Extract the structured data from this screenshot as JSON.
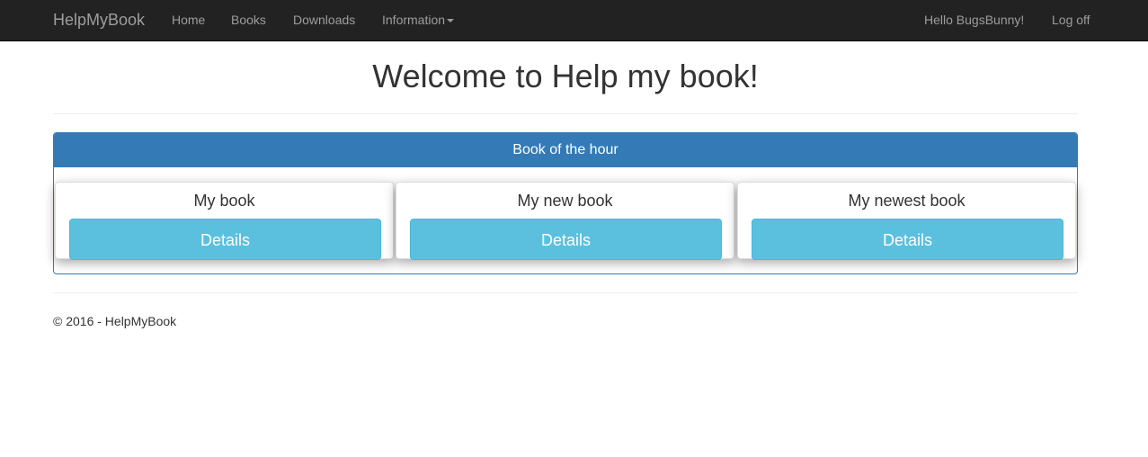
{
  "navbar": {
    "brand": "HelpMyBook",
    "links": [
      {
        "label": "Home"
      },
      {
        "label": "Books"
      },
      {
        "label": "Downloads"
      },
      {
        "label": "Information",
        "has_dropdown": true
      }
    ],
    "greeting": "Hello BugsBunny!",
    "logoff": "Log off"
  },
  "main": {
    "title": "Welcome to Help my book!",
    "panel": {
      "heading": "Book of the hour",
      "books": [
        {
          "title": "My book",
          "button": "Details"
        },
        {
          "title": "My new book",
          "button": "Details"
        },
        {
          "title": "My newest book",
          "button": "Details"
        }
      ]
    }
  },
  "footer": {
    "text": "© 2016 - HelpMyBook"
  },
  "colors": {
    "navbar_bg": "#222222",
    "nav_text": "#9d9d9d",
    "panel_primary": "#337ab7",
    "button_info": "#5bc0de"
  }
}
